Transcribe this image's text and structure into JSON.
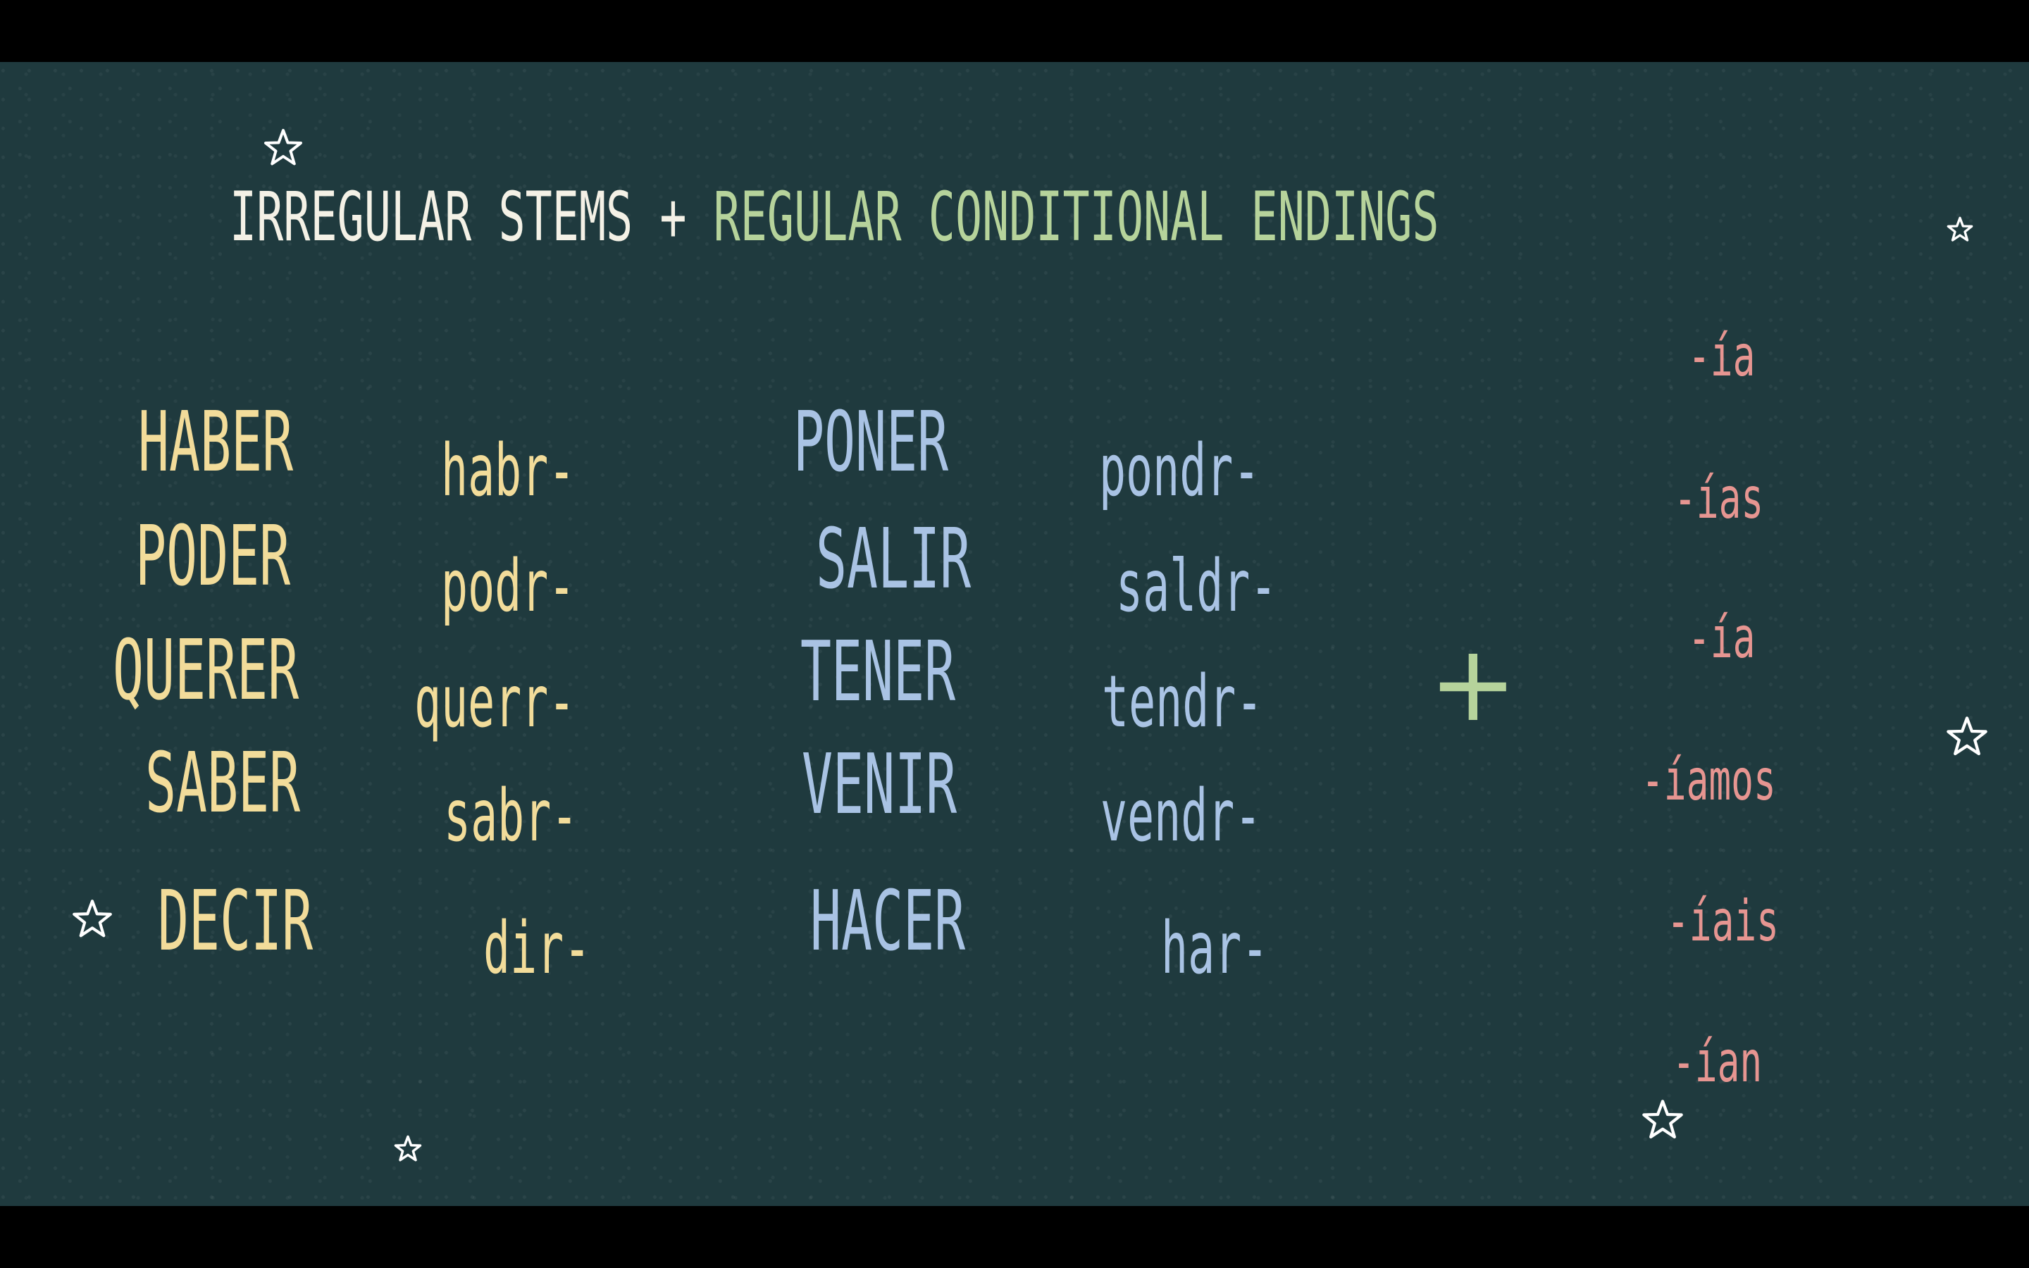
{
  "title": {
    "part1": "IRREGULAR STEMS",
    "plus": "+",
    "part2": "REGULAR CONDITIONAL ENDINGS"
  },
  "left_group": [
    {
      "verb": "HABER",
      "stem": "habr-"
    },
    {
      "verb": "PODER",
      "stem": "podr-"
    },
    {
      "verb": "QUERER",
      "stem": "querr-"
    },
    {
      "verb": "SABER",
      "stem": "sabr-"
    },
    {
      "verb": "DECIR",
      "stem": "dir-"
    }
  ],
  "right_group": [
    {
      "verb": "PONER",
      "stem": "pondr-"
    },
    {
      "verb": "SALIR",
      "stem": "saldr-"
    },
    {
      "verb": "TENER",
      "stem": "tendr-"
    },
    {
      "verb": "VENIR",
      "stem": "vendr-"
    },
    {
      "verb": "HACER",
      "stem": "har-"
    }
  ],
  "plus_sign": "+",
  "endings": [
    "-ía",
    "-ías",
    "-ía",
    "-íamos",
    "-íais",
    "-ían"
  ],
  "colors": {
    "background": "#1f3a3e",
    "title_white": "#f4f1e6",
    "title_green": "#b6d39b",
    "left_group": "#f2dc9a",
    "right_group": "#a9c3e4",
    "endings": "#e69591"
  },
  "icons": [
    "star-icon"
  ]
}
